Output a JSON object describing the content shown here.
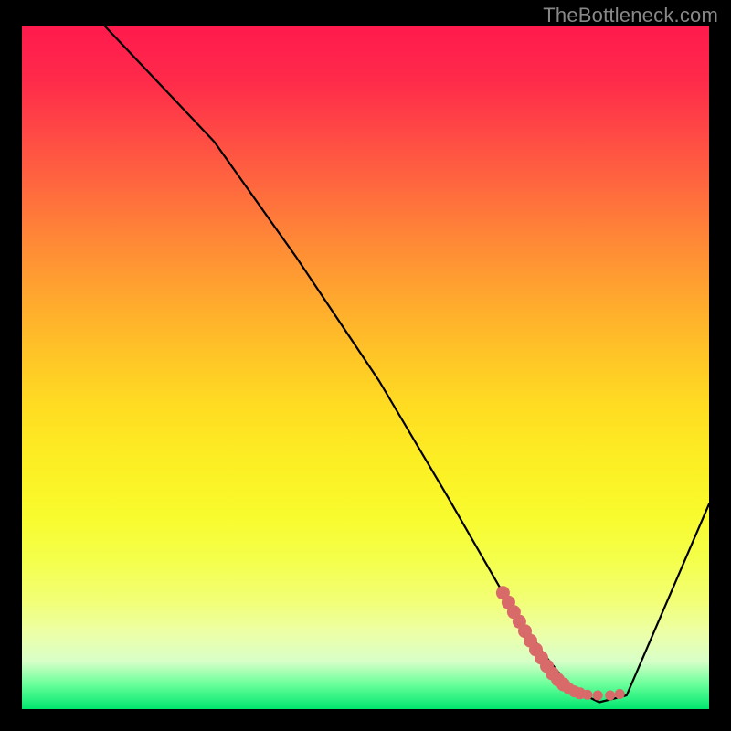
{
  "watermark": "TheBottleneck.com",
  "chart_data": {
    "type": "line",
    "title": "",
    "xlabel": "",
    "ylabel": "",
    "xlim": [
      0,
      100
    ],
    "ylim": [
      0,
      100
    ],
    "series": [
      {
        "name": "curve",
        "x": [
          0,
          12,
          28,
          40,
          52,
          62,
          70,
          76,
          80,
          84,
          88,
          100
        ],
        "y": [
          110,
          100,
          83,
          66,
          48,
          31,
          17,
          8,
          3,
          1,
          2,
          30
        ]
      }
    ],
    "markers": {
      "name": "highlight-dots",
      "color": "#d96a6a",
      "points": [
        {
          "x": 70.0,
          "y": 17.0
        },
        {
          "x": 70.8,
          "y": 15.6
        },
        {
          "x": 71.6,
          "y": 14.2
        },
        {
          "x": 72.4,
          "y": 12.8
        },
        {
          "x": 73.2,
          "y": 11.4
        },
        {
          "x": 74.0,
          "y": 10.0
        },
        {
          "x": 74.8,
          "y": 8.7
        },
        {
          "x": 75.6,
          "y": 7.5
        },
        {
          "x": 76.4,
          "y": 6.3
        },
        {
          "x": 77.2,
          "y": 5.2
        },
        {
          "x": 78.0,
          "y": 4.3
        },
        {
          "x": 78.8,
          "y": 3.6
        },
        {
          "x": 79.6,
          "y": 3.0
        },
        {
          "x": 80.4,
          "y": 2.6
        },
        {
          "x": 81.2,
          "y": 2.3
        },
        {
          "x": 82.3,
          "y": 2.1
        },
        {
          "x": 83.8,
          "y": 2.0
        },
        {
          "x": 85.6,
          "y": 2.0
        },
        {
          "x": 87.0,
          "y": 2.2
        }
      ]
    }
  }
}
